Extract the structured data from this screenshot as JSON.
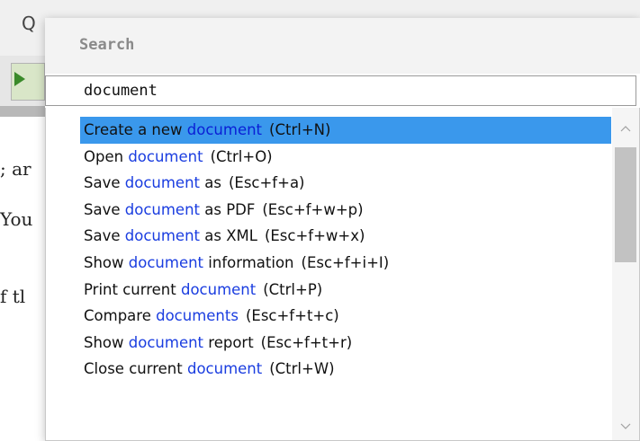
{
  "background": {
    "toolbar_letter": "Q",
    "text_fragments": [
      "; ar",
      "You",
      "f tl"
    ]
  },
  "palette": {
    "title": "Search",
    "query": "document",
    "items": [
      {
        "pre": "Create a new ",
        "match": "document",
        "post": "",
        "shortcut": "(Ctrl+N)",
        "selected": true
      },
      {
        "pre": "Open ",
        "match": "document",
        "post": "",
        "shortcut": "(Ctrl+O)",
        "selected": false
      },
      {
        "pre": "Save ",
        "match": "document",
        "post": " as",
        "shortcut": "(Esc+f+a)",
        "selected": false
      },
      {
        "pre": "Save ",
        "match": "document",
        "post": " as PDF",
        "shortcut": "(Esc+f+w+p)",
        "selected": false
      },
      {
        "pre": "Save ",
        "match": "document",
        "post": " as XML",
        "shortcut": "(Esc+f+w+x)",
        "selected": false
      },
      {
        "pre": "Show ",
        "match": "document",
        "post": " information",
        "shortcut": "(Esc+f+i+I)",
        "selected": false
      },
      {
        "pre": "Print current ",
        "match": "document",
        "post": "",
        "shortcut": "(Ctrl+P)",
        "selected": false
      },
      {
        "pre": "Compare ",
        "match": "documents",
        "post": "",
        "shortcut": "(Esc+f+t+c)",
        "selected": false
      },
      {
        "pre": "Show ",
        "match": "document",
        "post": " report",
        "shortcut": "(Esc+f+t+r)",
        "selected": false
      },
      {
        "pre": "Close current ",
        "match": "document",
        "post": "",
        "shortcut": "(Ctrl+W)",
        "selected": false
      }
    ],
    "scroll_up_glyph": "^",
    "scroll_down_glyph": "v",
    "colors": {
      "selected_bg": "#3a98ec",
      "match_text": "#1a3de0"
    }
  }
}
